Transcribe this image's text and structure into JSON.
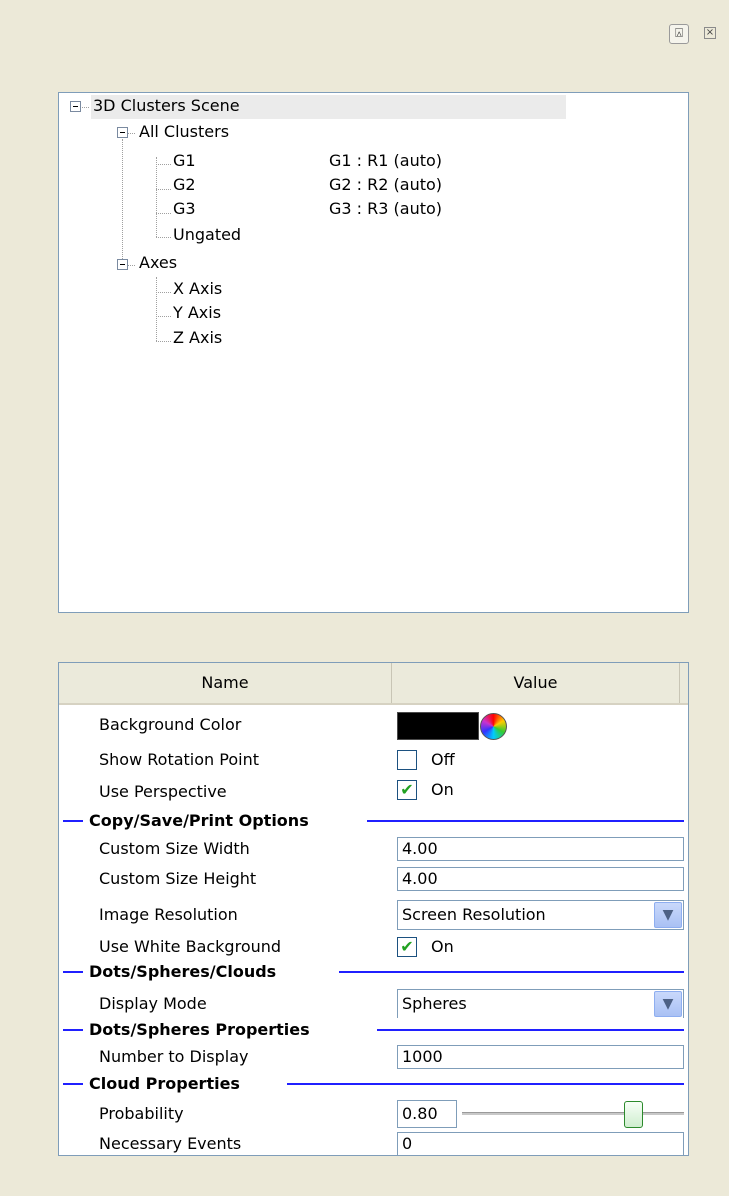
{
  "window": {
    "pin_glyph": "⍓",
    "close_glyph": "×"
  },
  "tree": {
    "root": {
      "label": "3D Clusters Scene"
    },
    "all_clusters": {
      "label": "All Clusters"
    },
    "clusters": [
      {
        "label": "G1",
        "value": "G1 : R1  (auto)"
      },
      {
        "label": "G2",
        "value": "G2 : R2  (auto)"
      },
      {
        "label": "G3",
        "value": "G3 : R3  (auto)"
      },
      {
        "label": "Ungated",
        "value": ""
      }
    ],
    "axes": {
      "label": "Axes"
    },
    "axis_items": [
      {
        "label": "X Axis"
      },
      {
        "label": "Y Axis"
      },
      {
        "label": "Z Axis"
      }
    ]
  },
  "grid": {
    "header": {
      "name": "Name",
      "value": "Value"
    },
    "background_color": {
      "name": "Background Color",
      "color": "#000000"
    },
    "show_rotation_point": {
      "name": "Show Rotation Point",
      "checked": false,
      "label": "Off",
      "check_glyph": ""
    },
    "use_perspective": {
      "name": "Use Perspective",
      "checked": true,
      "label": "On",
      "check_glyph": "✔"
    },
    "cat_copy": "Copy/Save/Print Options",
    "custom_width": {
      "name": "Custom Size Width",
      "value": "4.00"
    },
    "custom_height": {
      "name": "Custom Size Height",
      "value": "4.00"
    },
    "image_resolution": {
      "name": "Image Resolution",
      "value": "Screen Resolution"
    },
    "white_background": {
      "name": "Use White Background",
      "checked": true,
      "label": "On",
      "check_glyph": "✔"
    },
    "cat_dots": "Dots/Spheres/Clouds",
    "display_mode": {
      "name": "Display Mode",
      "value": "Spheres"
    },
    "cat_dots_props": "Dots/Spheres Properties",
    "number_to_display": {
      "name": "Number to Display",
      "value": "1000"
    },
    "cat_cloud": "Cloud Properties",
    "probability": {
      "name": "Probability",
      "value": "0.80",
      "slider_fraction": 0.8
    },
    "necessary_events": {
      "name": "Necessary Events",
      "value": "0"
    },
    "combo_arrow": "▼"
  },
  "colors": {
    "category_line": "#2020ff",
    "check_color": "#21a121"
  }
}
